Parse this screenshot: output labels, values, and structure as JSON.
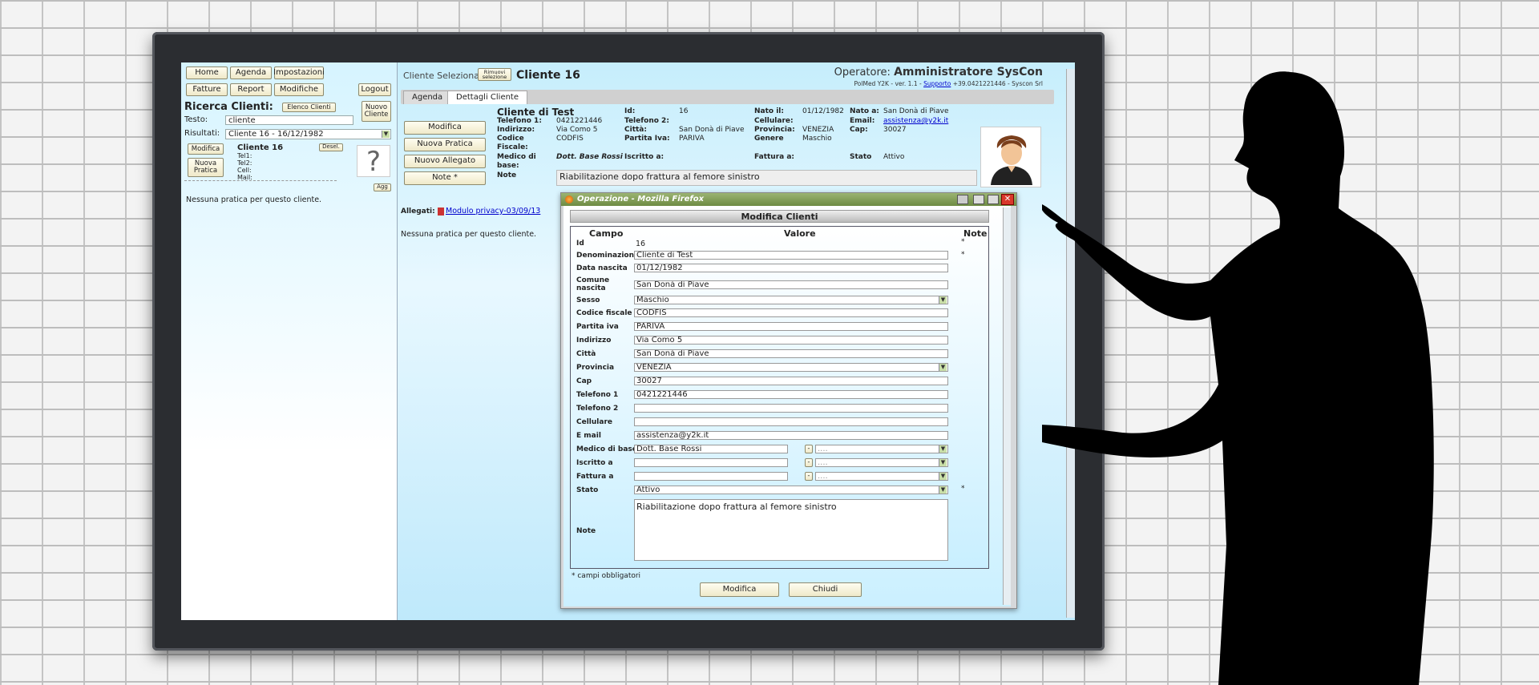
{
  "nav": {
    "home": "Home",
    "agenda": "Agenda",
    "impostazioni": "Impostazioni",
    "fatture": "Fatture",
    "report": "Report",
    "modifiche": "Modifiche",
    "logout": "Logout"
  },
  "search": {
    "title": "Ricerca Clienti:",
    "elenco_btn": "Elenco Clienti",
    "nuovo_btn": "Nuovo Cliente",
    "testo_label": "Testo:",
    "testo_value": "cliente",
    "risultati_label": "Risultati:",
    "risultati_value": "Cliente 16 - 16/12/1982"
  },
  "result_card": {
    "modifica": "Modifica",
    "nuova_pratica": "Nuova Pratica",
    "name": "Cliente 16",
    "desel": "Desel.",
    "tel1": "Tel1:",
    "tel2": "Tel2:",
    "cell": "Cell:",
    "mail": "Mail:",
    "question": "?",
    "agg": "Agg",
    "no_pratiche": "Nessuna pratica per questo cliente."
  },
  "header": {
    "selected_label": "Cliente Selezionato:",
    "rimuovi": "Rimuovi selezione",
    "selected_name": "Cliente 16",
    "operator_label": "Operatore:",
    "operator_name": "Amministratore SysCon",
    "version": "PolMed Y2K - ver. 1.1 - ",
    "support": "Supporto",
    "phone": " +39.0421221446 - Syscon Srl"
  },
  "tabs": {
    "agenda": "Agenda",
    "dettagli": "Dettagli Cliente"
  },
  "actions": {
    "modifica": "Modifica",
    "nuova_pratica": "Nuova Pratica",
    "nuovo_allegato": "Nuovo Allegato",
    "note": "Note *"
  },
  "details": {
    "title": "Cliente di Test",
    "id_label": "Id:",
    "id": "16",
    "nato_il_label": "Nato il:",
    "nato_il": "01/12/1982",
    "nato_a_label": "Nato a:",
    "nato_a": "San Donà di Piave",
    "tel1_label": "Telefono 1:",
    "tel1": "0421221446",
    "tel2_label": "Telefono 2:",
    "cell_label": "Cellulare:",
    "email_label": "Email:",
    "email": "assistenza@y2k.it",
    "indirizzo_label": "Indirizzo:",
    "indirizzo": "Via Como 5",
    "citta_label": "Città:",
    "citta": "San Donà di Piave",
    "provincia_label": "Provincia:",
    "provincia": "VENEZIA",
    "cap_label": "Cap:",
    "cap": "30027",
    "cf_label": "Codice Fiscale:",
    "cf": "CODFIS",
    "piva_label": "Partita Iva:",
    "piva": "PARIVA",
    "genere_label": "Genere",
    "genere": "Maschio",
    "medico_label": "Medico di base:",
    "medico": "Dott. Base Rossi",
    "iscritto_label": "Iscritto a:",
    "fattura_label": "Fattura a:",
    "stato_label": "Stato",
    "stato": "Attivo",
    "note_label": "Note",
    "note": "Riabilitazione dopo frattura al femore sinistro"
  },
  "allegati": {
    "label": "Allegati:",
    "file": "Modulo privacy-03/09/13",
    "no_pratiche": "Nessuna pratica per questo cliente."
  },
  "dialog": {
    "title": "Operazione - Mozilla Firefox",
    "heading": "Modifica Clienti",
    "col_campo": "Campo",
    "col_valore": "Valore",
    "col_note": "Note",
    "fields": {
      "id_l": "Id",
      "id_v": "16",
      "den_l": "Denominazione",
      "den_v": "Cliente di Test",
      "data_l": "Data nascita",
      "data_v": "01/12/1982",
      "comune_l": "Comune nascita",
      "comune_v": "San Donà di Piave",
      "sesso_l": "Sesso",
      "sesso_v": "Maschio",
      "cf_l": "Codice fiscale",
      "cf_v": "CODFIS",
      "piva_l": "Partita iva",
      "piva_v": "PARIVA",
      "ind_l": "Indirizzo",
      "ind_v": "Via Como 5",
      "citta_l": "Città",
      "citta_v": "San Donà di Piave",
      "prov_l": "Provincia",
      "prov_v": "VENEZIA",
      "cap_l": "Cap",
      "cap_v": "30027",
      "tel1_l": "Telefono 1",
      "tel1_v": "0421221446",
      "tel2_l": "Telefono 2",
      "tel2_v": "",
      "cell_l": "Cellulare",
      "cell_v": "",
      "email_l": "E mail",
      "email_v": "assistenza@y2k.it",
      "medico_l": "Medico di base",
      "medico_v": "Dott. Base Rossi",
      "iscritto_l": "Iscritto a",
      "fattura_l": "Fattura a",
      "stato_l": "Stato",
      "stato_v": "Attivo",
      "note_l": "Note",
      "note_v": "Riabilitazione dopo frattura al femore sinistro",
      "dash": "-",
      "dots": "....",
      "star": "*"
    },
    "required": "* campi obbligatori",
    "modifica": "Modifica",
    "chiudi": "Chiudi"
  }
}
